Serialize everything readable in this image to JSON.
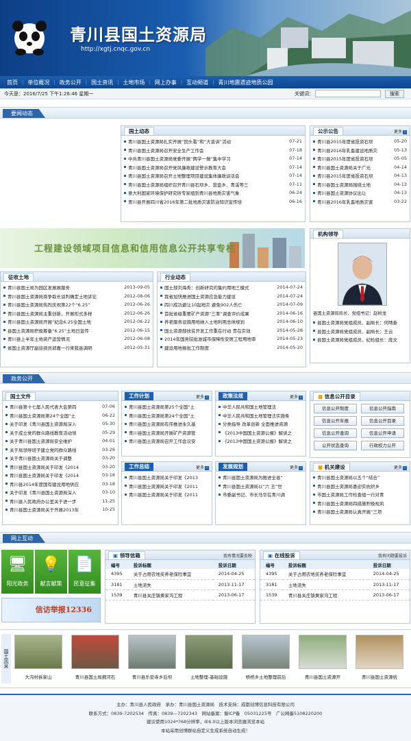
{
  "header": {
    "title": "青川县国土资源局",
    "url": "http://xgtj.cnqc.gov.cn"
  },
  "nav": [
    "首页",
    "单位概况",
    "政务公开",
    "国土资讯",
    "土地市场",
    "网上办事",
    "互动频道",
    "青川地震遗迹地质公园"
  ],
  "datebar": {
    "date": "今天是：2016/7/25 下午1:26:46 星期一",
    "keyword_label": "关键词：",
    "search_button": "搜索"
  },
  "sections": {
    "news": "要闻动态",
    "gov": "政务公开",
    "interact": "网上互动"
  },
  "guotu": {
    "title": "国土动态",
    "items": [
      {
        "t": "青川县国土资源局扎实开展“回头看”和“大普讲”活动",
        "d": "07-21"
      },
      {
        "t": "青川县国土资源局召开安全生产工作会",
        "d": "07-18"
      },
      {
        "t": "中共青川县国土资源局党委开展“两学一做”集中学习",
        "d": "07-14"
      },
      {
        "t": "青川县国土资源局召开党风廉政建设警示教育大会",
        "d": "07-14"
      },
      {
        "t": "青川县国土资源局召开土地整理项目建设集体廉政谈话会",
        "d": "07-14"
      },
      {
        "t": "青川县国土资源局组织召开青川县石坝乡、营盘乡、青溪等三",
        "d": "07-11"
      },
      {
        "t": "意大利国家环境保护研究所专家组到青川县地质灾害气象",
        "d": "06-24"
      },
      {
        "t": "青川县开展四川省2016年第二批地质灾害防治知识宣传培",
        "d": "06-16"
      }
    ]
  },
  "notice": {
    "title": "公示公告",
    "more": "更多",
    "items": [
      {
        "t": "青川县2015年度省投资石坝",
        "d": "05-20"
      },
      {
        "t": "青川县2016年乳畜建设地质灾",
        "d": "05-13"
      },
      {
        "t": "青川县2015年度省投资石坝",
        "d": "05-05"
      },
      {
        "t": "青川县国土资源局关于广元",
        "d": "04-14"
      },
      {
        "t": "青川县2015年度省投资石坝",
        "d": "04-13"
      },
      {
        "t": "青川县国土资源局围绕土地",
        "d": "04-13"
      },
      {
        "t": "青川县国土资源协议出让",
        "d": "04-13"
      },
      {
        "t": "青川县2016年乳畜地质灾害",
        "d": "03-22"
      }
    ]
  },
  "banner": "工程建设领域项目信息和信用信息公开共享专栏",
  "leader": {
    "title": "机构领导",
    "caption": "县国土资源局局长、党组书记：赵树龙",
    "items": [
      "县国土资源局党组成员、副局长：何晴泰",
      "县国土资源局党组成员、副局长：王云",
      "县国土资源局党组成员、纪检组长：庞文"
    ]
  },
  "land": {
    "title": "征收土地",
    "items": [
      {
        "t": "青川县国土局为园区发展展服务",
        "d": "2013-09-05"
      },
      {
        "t": "青川县国土资源局商争取长谈判确定土地诉论",
        "d": "2012-08-06"
      },
      {
        "t": "青川县国土资源局热烈庆祝第22个“6.25”",
        "d": "2012-06-26"
      },
      {
        "t": "青川县国土资源局主重创新，开展形式多样",
        "d": "2012-06-26"
      },
      {
        "t": "青川县国土资源局开展“纪念6.25全国土地",
        "d": "2012-06-22"
      },
      {
        "t": "县国土资源局积极筹备“6.25”土地日宣传",
        "d": "2012-06-15"
      },
      {
        "t": "青川县上半年土地资产运营情况",
        "d": "2012-06-08"
      },
      {
        "t": "省国土资源厅副巡视员郭嘉一行来我县调研",
        "d": "2012-05-31"
      }
    ]
  },
  "industry": {
    "title": "行业动态",
    "items": [
      {
        "t": "国土部刘海秀：创新研究的集约用地三模式",
        "d": "2014-07-24"
      },
      {
        "t": "我省加快推进国土资源应急能力建设",
        "d": "2014-07-24"
      },
      {
        "t": "四川成功避让10起地灾 避免902人伤亡",
        "d": "2014-07-09"
      },
      {
        "t": "首批省级重要矿产资源“三率”调查评价成果",
        "d": "2014-06-16"
      },
      {
        "t": "养老服务设施用地纳入土地利用总体规划",
        "d": "2014-06-10"
      },
      {
        "t": "国土资源部扶贫开发工作重在行动 贵在实效",
        "d": "2014-05-28"
      },
      {
        "t": "2014年国务院批准城市保障性安居工程用地审",
        "d": "2014-05-23"
      },
      {
        "t": "建设用地报批工作制度",
        "d": "2014-05-20"
      }
    ]
  },
  "docs": {
    "title": "国土文件",
    "items": [
      {
        "t": "青川县第十七届人民代表大会第四",
        "d": "07-06"
      },
      {
        "t": "青川县国土资源局第24个全国“土",
        "d": "06-22"
      },
      {
        "t": "关于印发《青川县国土资源局深入",
        "d": "05-30"
      },
      {
        "t": "关于成立党的群众路线教育活动领",
        "d": "05-29"
      },
      {
        "t": "关于青川县国土资源局安全维护",
        "d": "04-01"
      },
      {
        "t": "关于局领导班子建立党的群众路线",
        "d": "03-26"
      },
      {
        "t": "关于青川县国土资源局关于调整",
        "d": "03-20"
      },
      {
        "t": "青川县国土资源局关于印发《2014",
        "d": "03-20"
      },
      {
        "t": "青川县国土资源局关于印发《2014",
        "d": "03-18"
      },
      {
        "t": "青川县2014年度国有建设用地供应",
        "d": "03-18"
      },
      {
        "t": "关于印发《青川县国土资源局深入",
        "d": "03-10"
      },
      {
        "t": "青川县人民政府办公室关于进一步",
        "d": "11-25"
      },
      {
        "t": "青川县国土资源局关于开展2013年",
        "d": "10-25"
      }
    ]
  },
  "plan": {
    "title": "工作计划",
    "more": "更多",
    "items": [
      "青川县国土资源局第25个全国“土",
      "青川县国土资源局第24个全国“土",
      "青川县国土资源局有序推进永久基",
      "青川县国土资源局开展矿产资源管",
      "青川县国土资源局召开工作会议安"
    ]
  },
  "policy": {
    "title": "政策法规",
    "more": "更多",
    "items": [
      "中华人民共和国土地管理法",
      "中华人民共和国土地管理法实施条",
      "分类指导 改革创新 全面推进资源",
      "《2013中国国土资源公报》解读之",
      "《2013中国国土资源公报》解读之"
    ]
  },
  "summary": {
    "title": "工作总结",
    "more": "更多",
    "items": [
      "青川县国土资源局关于印发《2013",
      "青川县国土资源局关于印发《2011",
      "青川县国土资源局关于印发《2011"
    ]
  },
  "develop": {
    "title": "发展规划",
    "more": "更多",
    "items": [
      "青川县国土资源局为推进全县“",
      "青川县国土资源局以“六 五”世",
      "市委副书记、市长马华在青川调"
    ]
  },
  "opendir": {
    "title": "信息公开目录",
    "buttons": [
      "信息公开制度",
      "信息公开指南",
      "信息公开年报",
      "信息公开目录",
      "信息公开查询",
      "信息公开申请",
      "公开状态查询",
      "行政权力公开"
    ]
  },
  "build": {
    "title": "机关建设",
    "more": "更多",
    "items": [
      "青川县国土资源局以五个“结合”",
      "青川县国土资源局喜迎实抗织乡",
      "市国土资源局工作检查组一行对青",
      "青川县国土资源局四措施积极规风",
      "青川县国土资源局认真开展“三项"
    ]
  },
  "interact": {
    "tiles": [
      "阳光政务",
      "献言献策",
      "民意征集"
    ],
    "report": "信访举报12336"
  },
  "mailbox": {
    "title": "领导信箱",
    "link": "我有情况要反映",
    "cols": [
      "编号",
      "投诉标题",
      "投诉日期"
    ],
    "rows": [
      {
        "id": "4395",
        "t": "关于占用农地买养老保险事宜",
        "d": "2014-04-25"
      },
      {
        "id": "3181",
        "t": "土地流失",
        "d": "2013-11-17"
      },
      {
        "id": "1539",
        "t": "青川县关庄镇黄家沟工程",
        "d": "2013-06-17"
      }
    ]
  },
  "complaint": {
    "title": "在线投诉",
    "link": "我有问题要投诉",
    "cols": [
      "编号",
      "投诉标题",
      "投诉日期"
    ],
    "rows": [
      {
        "id": "4395",
        "t": "关于占用农地买养老保险事宜",
        "d": "2014-04-25"
      },
      {
        "id": "3181",
        "t": "土地流失",
        "d": "2013-11-17"
      },
      {
        "id": "1539",
        "t": "青川县关庄镇黄家沟工程",
        "d": "2013-06-17"
      }
    ]
  },
  "gallery": {
    "label": "国土风采",
    "captions": [
      "大沟村拆家山",
      "青川县国土局拥河石",
      "青川县乐安寺乡后坝",
      "土地整理-基础设施",
      "桥桥乡土地整理前后",
      "青川县国土资源开",
      "青川县国土资源统"
    ]
  },
  "footer": [
    "主办：青川县人民政府　承办：青川县国土资源局　技术支持：成都创博信息科技有限公司",
    "联系方式：0839-7202534　传真：0839—7202343　网站备案：蜀ICP备　05031225号　广公网备5108220200",
    "建议使用1024*768分辨率，IE6.0以上版本浏览器浏览本站",
    "本站采用创博群站自定义生成系统自动生成！"
  ]
}
